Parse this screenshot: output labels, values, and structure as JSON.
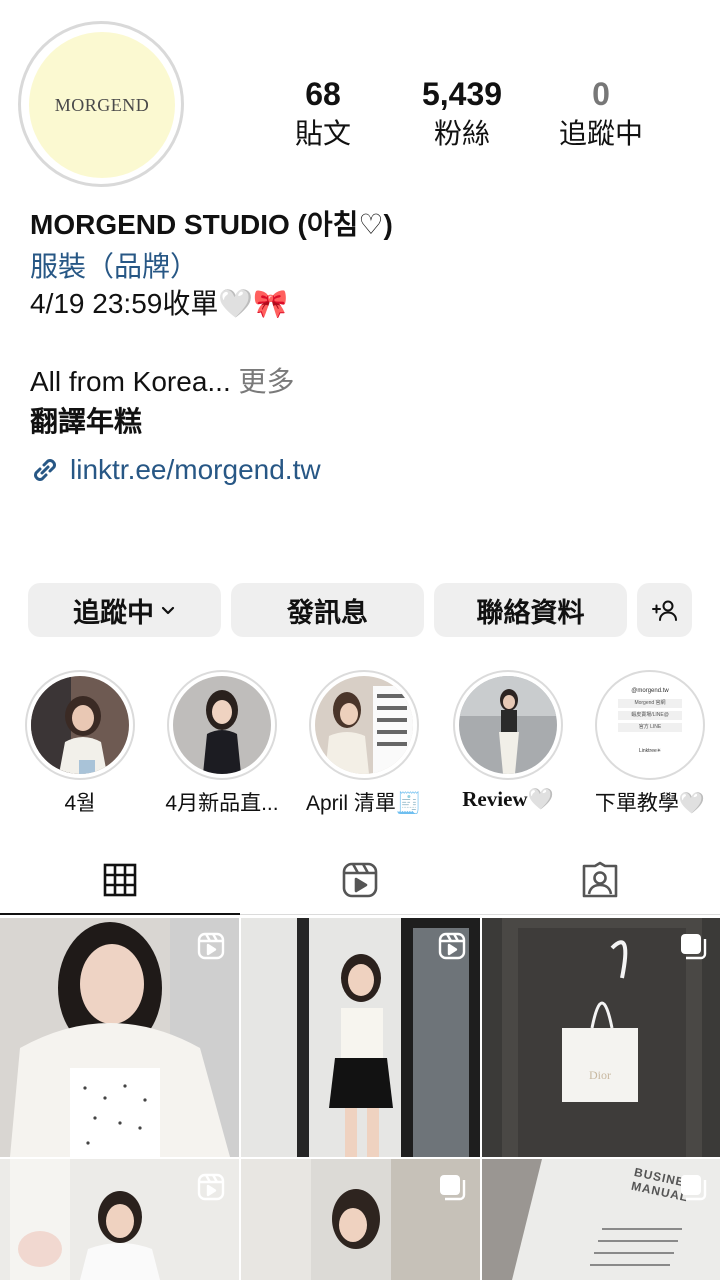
{
  "profile": {
    "avatar_text": "MORGEND",
    "name": "MORGEND STUDIO (아침♡)",
    "category": "服裝（品牌）",
    "bio_line1": "4/19 23:59收單🤍🎀",
    "bio_line2": "All from Korea...",
    "bio_more": " 更多",
    "bio_translate": "翻譯年糕",
    "link": "linktr.ee/morgend.tw"
  },
  "stats": [
    {
      "value": "68",
      "label": "貼文"
    },
    {
      "value": "5,439",
      "label": "粉絲"
    },
    {
      "value": "0",
      "label": "追蹤中"
    }
  ],
  "buttons": {
    "following": "追蹤中",
    "message": "發訊息",
    "contact": "聯絡資料"
  },
  "highlights": [
    {
      "label": "4월"
    },
    {
      "label": "4月新品直..."
    },
    {
      "label": "April 清單🧾"
    },
    {
      "label": "Review🤍"
    },
    {
      "label": "下單教學🤍"
    }
  ],
  "tabs": [
    "grid-icon",
    "reels-icon",
    "tagged-icon"
  ],
  "highlight_cover_text": {
    "handle": "@morgend.tw",
    "lines": [
      "Morgend 官網",
      "蝦皮賣場/LINE@",
      "官方 LINE"
    ],
    "footer": "Linktree✳"
  },
  "grid_tiles": [
    {
      "badge": "reel-icon"
    },
    {
      "badge": "reel-icon"
    },
    {
      "badge": "carousel-icon",
      "bag_text": "Dior"
    },
    {
      "badge": "reel-icon"
    },
    {
      "badge": "carousel-icon"
    },
    {
      "badge": "carousel-icon",
      "text": "BUSINESS MANUAL"
    }
  ]
}
